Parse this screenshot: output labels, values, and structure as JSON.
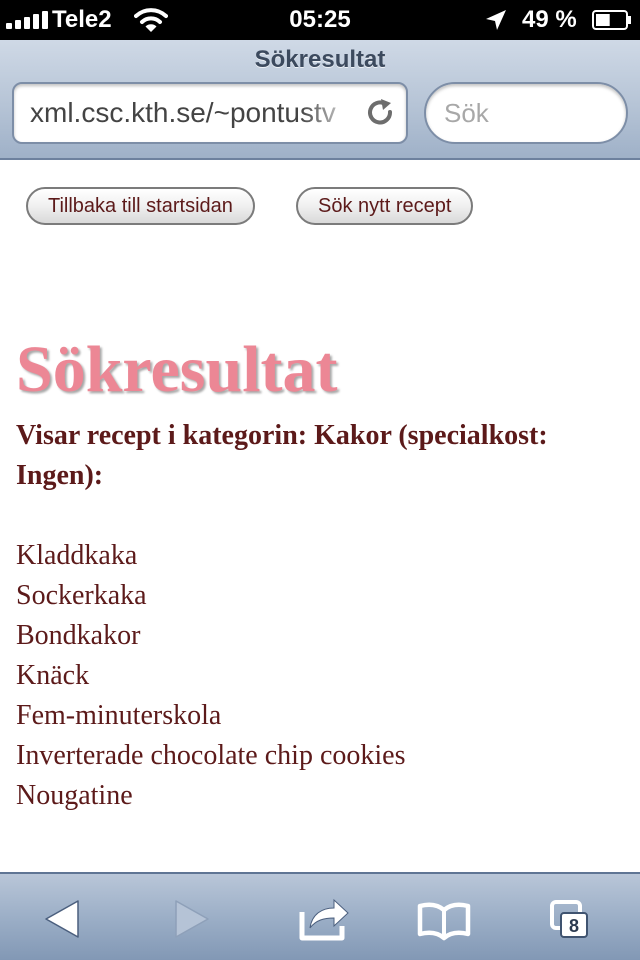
{
  "status_bar": {
    "carrier": "Tele2",
    "time": "05:25",
    "battery_percent": "49 %",
    "battery_level": 0.49
  },
  "browser": {
    "page_title": "Sökresultat",
    "url": "xml.csc.kth.se/~pontustv",
    "search_placeholder": "Sök",
    "open_pages_count": "8"
  },
  "page": {
    "buttons": {
      "back_to_start": "Tillbaka till startsidan",
      "new_search": "Sök nytt recept"
    },
    "heading": "Sökresultat",
    "subheading": "Visar recept i kategorin: Kakor (specialkost: Ingen):",
    "recipes": [
      "Kladdkaka",
      "Sockerkaka",
      "Bondkakor",
      "Knäck",
      "Fem-minuterskola",
      "Inverterade chocolate chip cookies",
      "Nougatine"
    ]
  },
  "colors": {
    "heading": "#ec8795",
    "text": "#5c1a1a",
    "nav_bar": "#b6c4d6",
    "toolbar": "#9cafc7"
  },
  "icons": {
    "signal": "signal-strength-icon",
    "wifi": "wifi-icon",
    "location": "location-arrow-icon",
    "battery": "battery-icon",
    "reload": "reload-icon",
    "back": "back-arrow-icon",
    "forward": "forward-arrow-icon",
    "share": "share-icon",
    "bookmarks": "bookmarks-icon",
    "pages": "pages-icon"
  }
}
